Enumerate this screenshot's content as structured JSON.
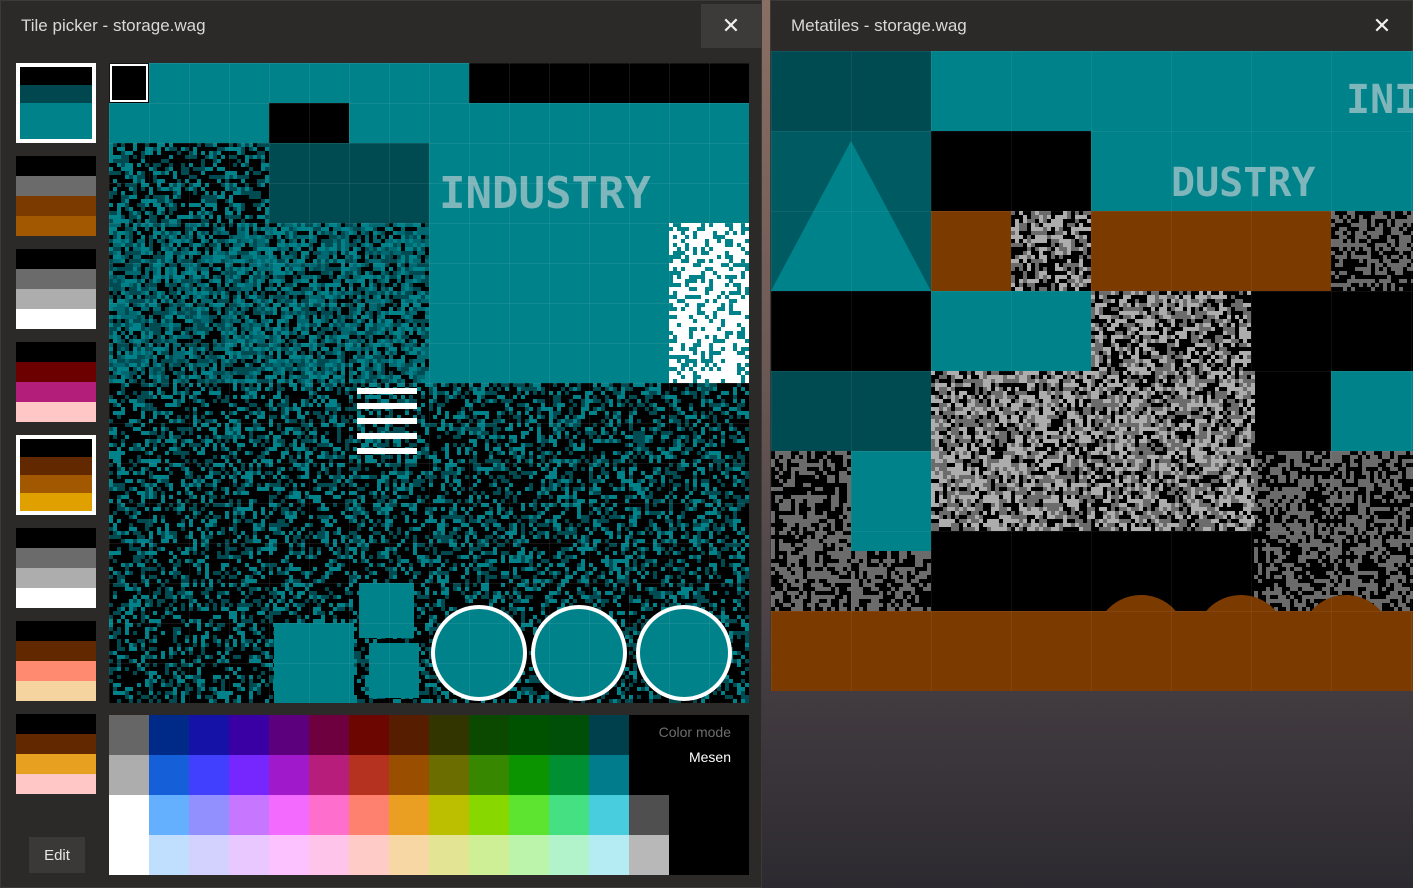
{
  "tile_picker": {
    "title": "Tile picker - storage.wag",
    "close_glyph": "✕",
    "edit_label": "Edit",
    "color_mode_label": "Color mode",
    "color_mode_value": "Mesen"
  },
  "metatiles": {
    "title": "Metatiles - storage.wag",
    "close_glyph": "✕"
  },
  "palettes": [
    {
      "colors": [
        "#000000",
        "#00474f",
        "#00828a",
        "#00828a"
      ],
      "selected": true
    },
    {
      "colors": [
        "#000000",
        "#6b6b6b",
        "#7b3a00",
        "#a15800"
      ],
      "selected": false
    },
    {
      "colors": [
        "#000000",
        "#6b6b6b",
        "#adadad",
        "#ffffff"
      ],
      "selected": false
    },
    {
      "colors": [
        "#000000",
        "#6c0000",
        "#b31e7b",
        "#ffc8c6"
      ],
      "selected": false
    },
    {
      "colors": [
        "#000000",
        "#622900",
        "#a15800",
        "#e0a000"
      ],
      "selected": true
    },
    {
      "colors": [
        "#000000",
        "#6b6b6b",
        "#adadad",
        "#ffffff"
      ],
      "selected": false
    },
    {
      "colors": [
        "#000000",
        "#622900",
        "#ff8a70",
        "#f5d4a0"
      ],
      "selected": false
    },
    {
      "colors": [
        "#000000",
        "#622900",
        "#e8a020",
        "#ffc8c6"
      ],
      "selected": false
    }
  ],
  "nes_palette": [
    "#666666",
    "#002a88",
    "#1412a7",
    "#3b00a4",
    "#5c007e",
    "#6e0040",
    "#6c0600",
    "#561d00",
    "#333500",
    "#0b4800",
    "#005200",
    "#004f08",
    "#00404d",
    "#000000",
    "#000000",
    "#000000",
    "#adadad",
    "#155fd9",
    "#4240ff",
    "#7527fe",
    "#a01acc",
    "#b71e7b",
    "#b53120",
    "#994e00",
    "#6b6d00",
    "#388700",
    "#0c9300",
    "#008f32",
    "#007c8d",
    "#000000",
    "#000000",
    "#000000",
    "#ffffff",
    "#64b0ff",
    "#9290ff",
    "#c676ff",
    "#f36aff",
    "#fe6ecc",
    "#fe8170",
    "#ea9e22",
    "#bcbe00",
    "#88d800",
    "#5ce430",
    "#45e082",
    "#48cdde",
    "#4f4f4f",
    "#000000",
    "#000000",
    "#ffffff",
    "#c0dfff",
    "#d3d2ff",
    "#e8c8ff",
    "#fbc2ff",
    "#fec4ea",
    "#fecbc6",
    "#f7d8a5",
    "#e4e594",
    "#cfef96",
    "#bdf4ab",
    "#b3f3cc",
    "#b5ebf2",
    "#b8b8b8",
    "#000000",
    "#000000"
  ],
  "tile_text": "INDUSTRY",
  "meta_text_1": "DUSTRY",
  "meta_text_2": "INI",
  "colors": {
    "teal": "#00828a",
    "dark_teal": "#004a52",
    "brown": "#7b3a00",
    "orange": "#a15800",
    "gray": "#6b6b6b",
    "light_gray": "#adadad",
    "white": "#ffffff",
    "black": "#000000"
  }
}
